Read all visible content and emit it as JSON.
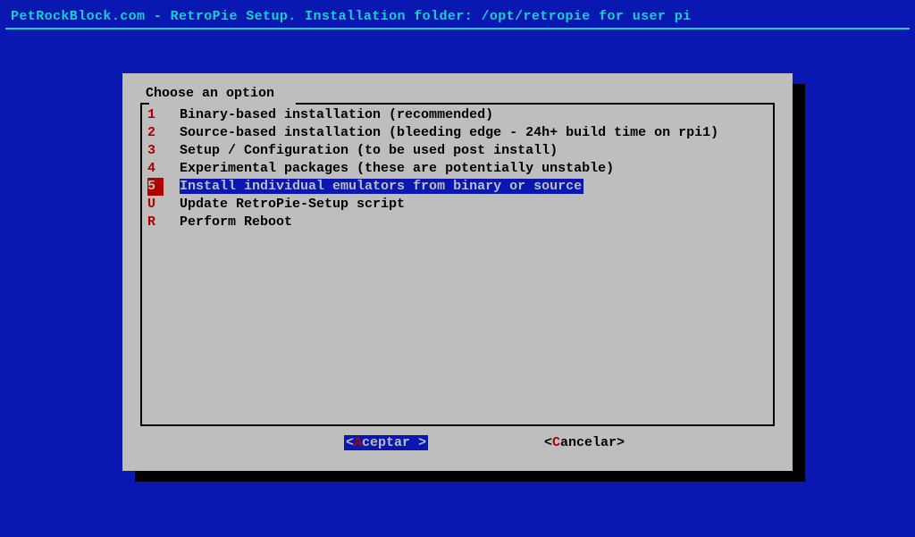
{
  "header": "PetRockBlock.com - RetroPie Setup. Installation folder: /opt/retropie for user pi",
  "prompt": "Choose an option",
  "selected_index": 4,
  "options": [
    {
      "key": "1",
      "label": "Binary-based installation (recommended)"
    },
    {
      "key": "2",
      "label": "Source-based installation (bleeding edge - 24h+ build time on rpi1)"
    },
    {
      "key": "3",
      "label": "Setup / Configuration (to be used post install)"
    },
    {
      "key": "4",
      "label": "Experimental packages (these are potentially unstable)"
    },
    {
      "key": "5",
      "label": "Install individual emulators from binary or source"
    },
    {
      "key": "U",
      "label": "Update RetroPie-Setup script"
    },
    {
      "key": "R",
      "label": "Perform Reboot"
    }
  ],
  "buttons": {
    "accept": {
      "pre": "<",
      "hotkey": "A",
      "rest": "ceptar >",
      "active": true
    },
    "cancel": {
      "pre": "<",
      "hotkey": "C",
      "rest": "ancelar>",
      "active": false
    }
  }
}
